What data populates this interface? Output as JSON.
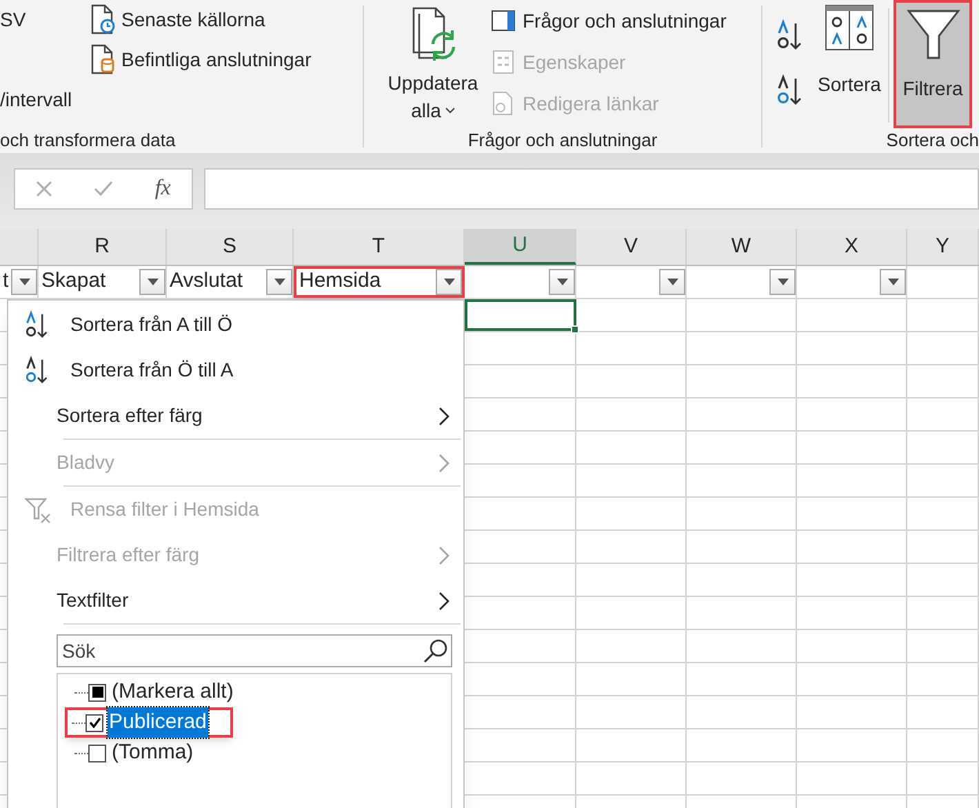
{
  "ribbon": {
    "get_data_group": {
      "label": "och transformera data",
      "items": [
        {
          "label": "SV"
        },
        {
          "label": "/intervall"
        }
      ],
      "commands": [
        {
          "label": "Senaste källorna"
        },
        {
          "label": "Befintliga anslutningar"
        }
      ]
    },
    "queries_group": {
      "label": "Frågor och anslutningar",
      "refresh": {
        "lines": [
          "Uppdatera",
          "alla"
        ]
      },
      "commands": [
        {
          "label": "Frågor och anslutningar",
          "disabled": false
        },
        {
          "label": "Egenskaper",
          "disabled": true
        },
        {
          "label": "Redigera länkar",
          "disabled": true
        }
      ]
    },
    "sort_group": {
      "label": "Sortera och",
      "sort_button": {
        "label": "Sortera"
      },
      "filter_button": {
        "label": "Filtrera",
        "selected": true,
        "highlighted": true
      }
    }
  },
  "formula_bar": {
    "function_label": "fx"
  },
  "sheet": {
    "columns": [
      {
        "selected": false
      },
      {
        "letter": "R",
        "selected": false
      },
      {
        "letter": "S",
        "selected": false
      },
      {
        "letter": "T",
        "selected": false
      },
      {
        "letter": "U",
        "selected": true
      },
      {
        "letter": "V",
        "selected": false
      },
      {
        "letter": "W",
        "selected": false
      },
      {
        "letter": "X",
        "selected": false
      },
      {
        "letter": "Y",
        "selected": false
      }
    ],
    "filter_row": [
      {
        "text": "t",
        "filter_button": true,
        "highlighted": false
      },
      {
        "text": "Skapat",
        "filter_button": true,
        "highlighted": false
      },
      {
        "text": "Avslutat",
        "filter_button": true,
        "highlighted": false
      },
      {
        "text": "Hemsida",
        "filter_button": true,
        "highlighted": true
      },
      {
        "filter_button": true,
        "highlighted": false
      },
      {
        "filter_button": true,
        "highlighted": false
      },
      {
        "filter_button": true,
        "highlighted": false
      },
      {
        "filter_button": true,
        "highlighted": false
      },
      {
        "filter_button": false,
        "highlighted": false
      }
    ]
  },
  "filter_menu": {
    "items": [
      {
        "kind": "sort_ascending",
        "label": "Sortera från A till Ö",
        "disabled": false,
        "submenu": false
      },
      {
        "kind": "sort_descending",
        "label": "Sortera från Ö till A",
        "disabled": false,
        "submenu": false
      },
      {
        "kind": "plain",
        "label": "Sortera efter färg",
        "disabled": false,
        "submenu": true
      },
      {
        "kind": "separator"
      },
      {
        "kind": "plain",
        "label": "Bladvy",
        "disabled": true,
        "submenu": true
      },
      {
        "kind": "separator"
      },
      {
        "kind": "clear_filter",
        "label": "Rensa filter i Hemsida",
        "disabled": true,
        "submenu": false
      },
      {
        "kind": "plain",
        "label": "Filtrera efter färg",
        "disabled": true,
        "submenu": true
      },
      {
        "kind": "plain",
        "label": "Textfilter",
        "disabled": false,
        "submenu": true
      },
      {
        "kind": "separator"
      }
    ],
    "search": {
      "placeholder": "Sök"
    },
    "values": [
      {
        "label": "(Markera allt)",
        "checked": false,
        "partial": true,
        "selected": false,
        "highlighted": false
      },
      {
        "label": "Publicerad",
        "checked": true,
        "partial": false,
        "selected": true,
        "highlighted": true
      },
      {
        "label": "(Tomma)",
        "checked": false,
        "partial": false,
        "selected": false,
        "highlighted": false
      }
    ]
  }
}
